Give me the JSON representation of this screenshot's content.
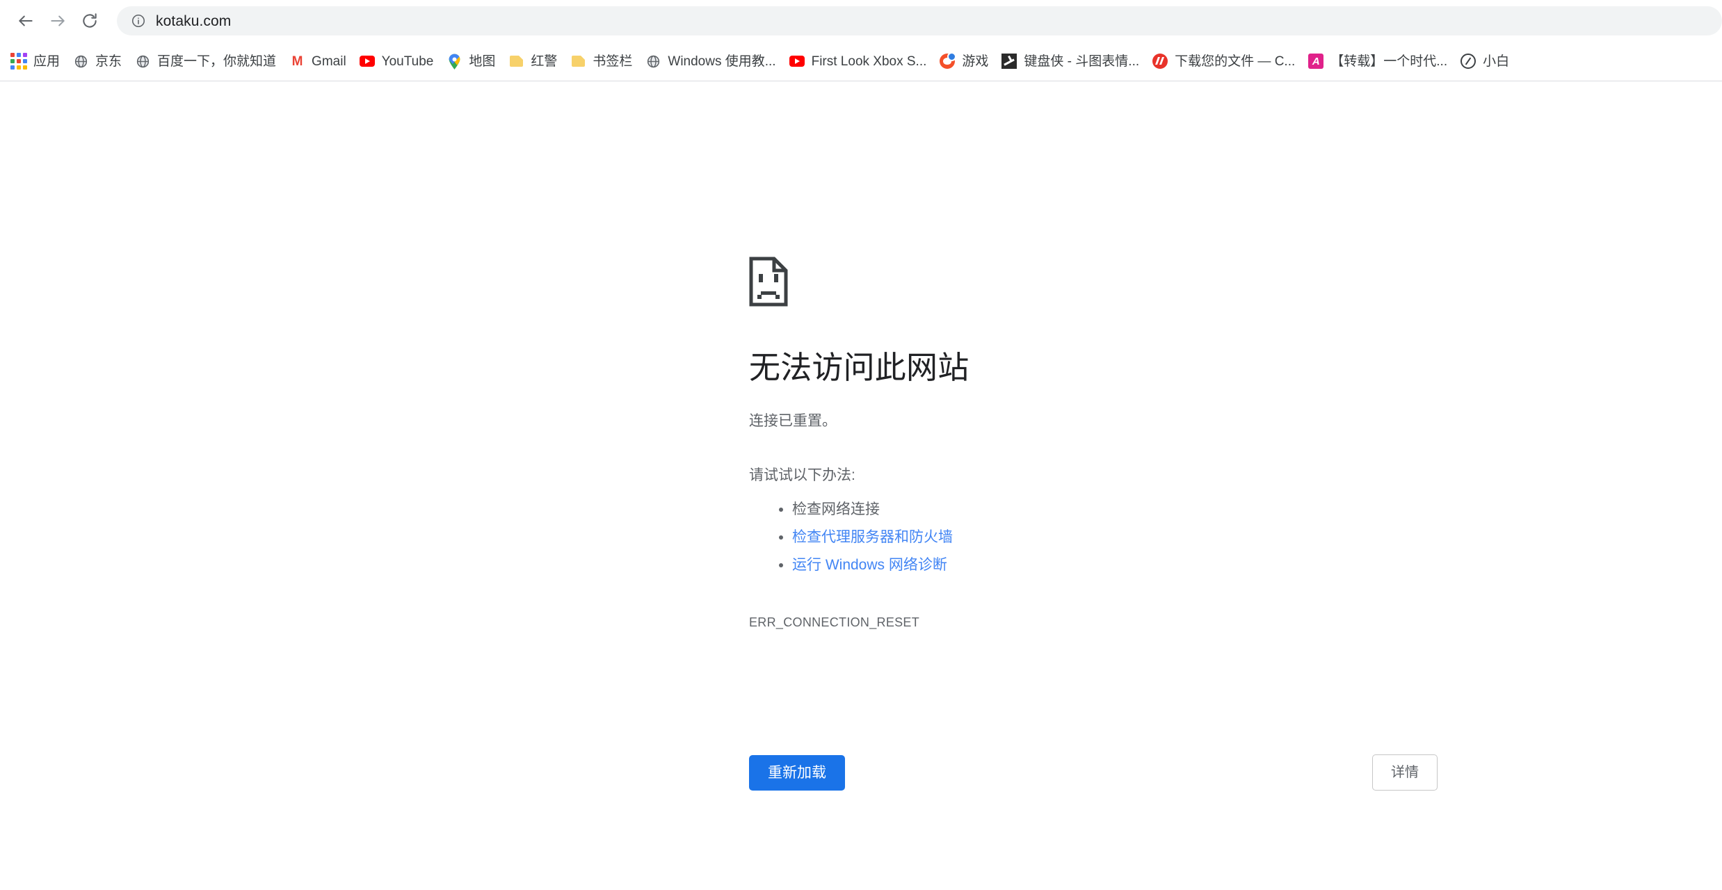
{
  "browser": {
    "back_icon": "back-arrow-icon",
    "forward_icon": "forward-arrow-icon",
    "reload_icon": "reload-icon",
    "omnibox": {
      "info_icon": "page-info-icon",
      "url": "kotaku.com"
    }
  },
  "bookmarks": {
    "apps_label": "应用",
    "items": [
      {
        "label": "京东",
        "icon": "globe-icon"
      },
      {
        "label": "百度一下，你就知道",
        "icon": "globe-icon"
      },
      {
        "label": "Gmail",
        "icon": "gmail-icon"
      },
      {
        "label": "YouTube",
        "icon": "youtube-icon"
      },
      {
        "label": "地图",
        "icon": "google-maps-pin-icon"
      },
      {
        "label": "红警",
        "icon": "folder-icon"
      },
      {
        "label": "书签栏",
        "icon": "folder-icon"
      },
      {
        "label": "Windows 使用教...",
        "icon": "globe-icon"
      },
      {
        "label": "First Look Xbox S...",
        "icon": "youtube-icon"
      },
      {
        "label": "游戏",
        "icon": "game-face-icon"
      },
      {
        "label": "键盘侠 - 斗图表情...",
        "icon": "dark-square-icon"
      },
      {
        "label": "下载您的文件 — C...",
        "icon": "red-circle-icon"
      },
      {
        "label": "【转载】一个时代...",
        "icon": "pink-a-icon"
      },
      {
        "label": "小白",
        "icon": "compass-icon"
      }
    ]
  },
  "error_page": {
    "sad_icon": "sad-page-icon",
    "title": "无法访问此网站",
    "subtitle": "连接已重置。",
    "suggestions_heading": "请试试以下办法:",
    "suggestions": [
      {
        "text": "检查网络连接",
        "is_link": false
      },
      {
        "text": "检查代理服务器和防火墙",
        "is_link": true
      },
      {
        "text": "运行 Windows 网络诊断",
        "is_link": true
      }
    ],
    "error_code": "ERR_CONNECTION_RESET",
    "reload_button": "重新加载",
    "details_button": "详情",
    "colors": {
      "primary_blue": "#1a73e8",
      "link_blue": "#4285f4",
      "body_gray": "#5f6368",
      "title_gray": "#202124"
    }
  }
}
